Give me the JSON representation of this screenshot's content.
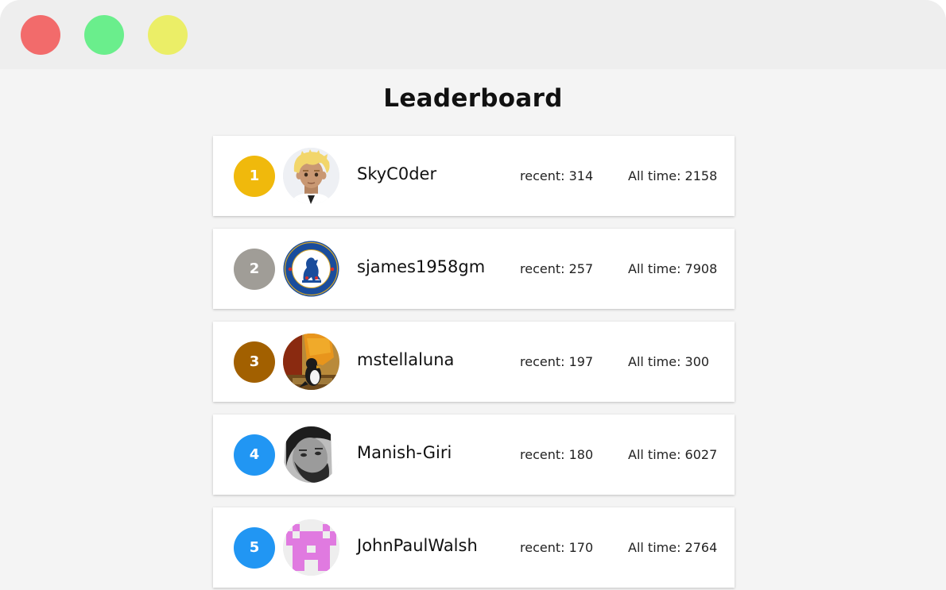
{
  "window": {
    "controls": [
      {
        "name": "close",
        "color": "#f26b6b"
      },
      {
        "name": "minimize",
        "color": "#6aee8c"
      },
      {
        "name": "maximize",
        "color": "#ebee67"
      }
    ]
  },
  "page": {
    "title": "Leaderboard"
  },
  "leaderboard": [
    {
      "rank": "1",
      "rank_color": "#f0b90c",
      "avatar": "cartoon-blonde-avatar",
      "username": "SkyC0der",
      "recent": "recent: 314",
      "all_time": "All time: 2158"
    },
    {
      "rank": "2",
      "rank_color": "#a09d97",
      "avatar": "chelsea-crest-avatar",
      "username": "sjames1958gm",
      "recent": "recent: 257",
      "all_time": "All time: 7908"
    },
    {
      "rank": "3",
      "rank_color": "#a26000",
      "avatar": "cartoon-penguin-avatar",
      "username": "mstellaluna",
      "recent": "recent: 197",
      "all_time": "All time: 300"
    },
    {
      "rank": "4",
      "rank_color": "#2196f3",
      "avatar": "photo-man-avatar",
      "username": "Manish-Giri",
      "recent": "recent: 180",
      "all_time": "All time: 6027"
    },
    {
      "rank": "5",
      "rank_color": "#2196f3",
      "avatar": "pixel-identicon-avatar",
      "username": "JohnPaulWalsh",
      "recent": "recent: 170",
      "all_time": "All time: 2764"
    }
  ]
}
